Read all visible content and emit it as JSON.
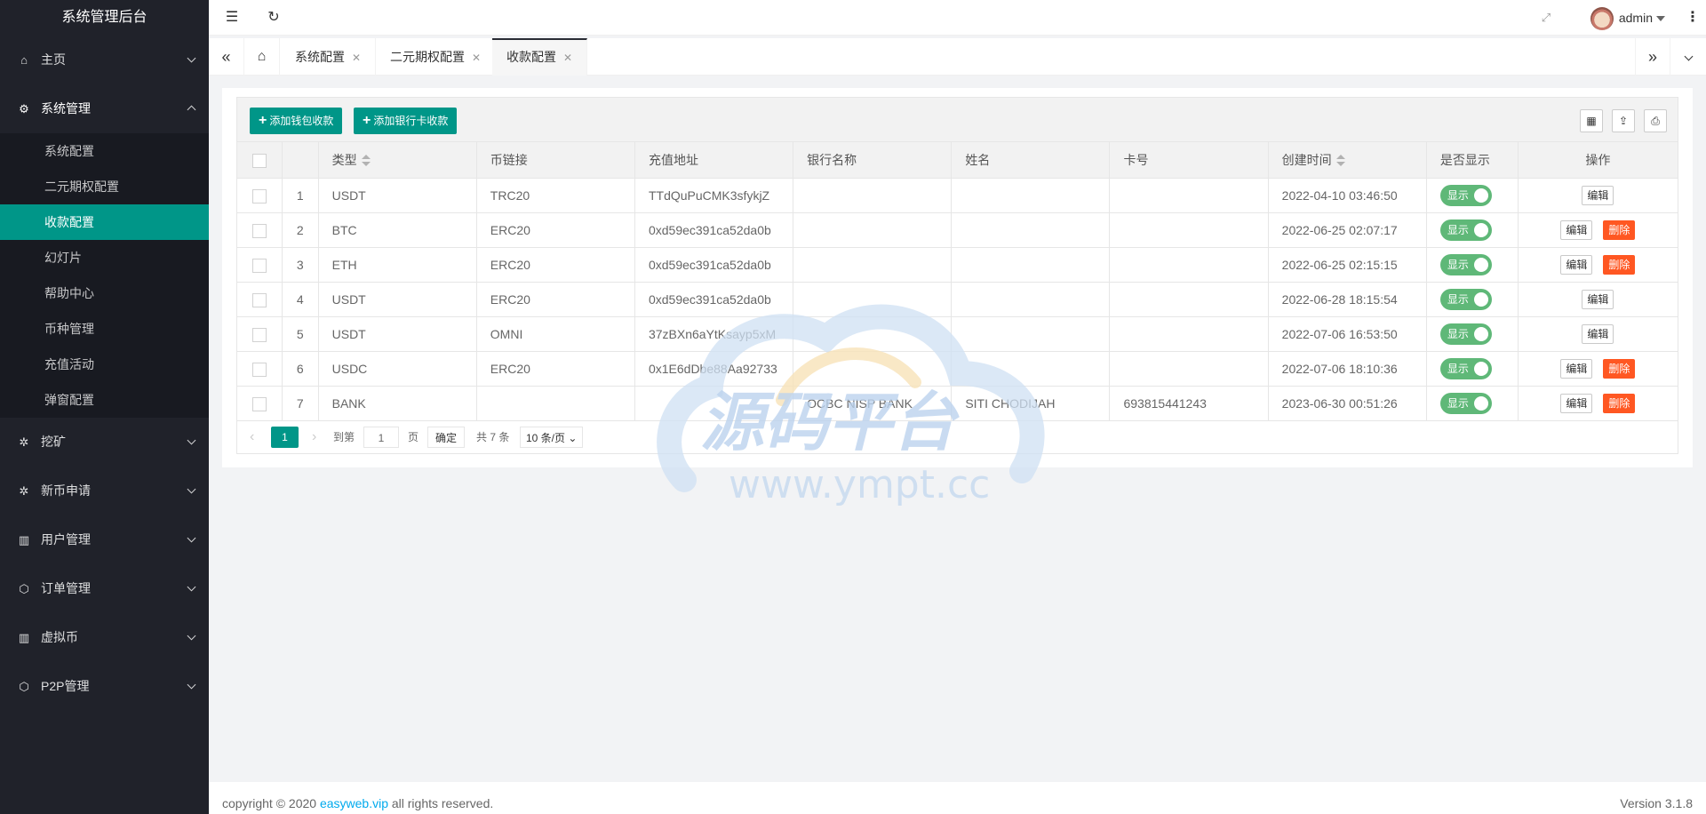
{
  "app": {
    "title": "系统管理后台"
  },
  "sidebar": {
    "items": [
      {
        "label": "主页",
        "icon": "home-icon"
      },
      {
        "label": "系统管理",
        "icon": "gear-icon",
        "open": true,
        "children": [
          "系统配置",
          "二元期权配置",
          "收款配置",
          "幻灯片",
          "帮助中心",
          "币种管理",
          "充值活动",
          "弹窗配置"
        ],
        "active_child": "收款配置"
      },
      {
        "label": "挖矿",
        "icon": "settings-icon"
      },
      {
        "label": "新币申请",
        "icon": "settings-icon"
      },
      {
        "label": "用户管理",
        "icon": "book-icon"
      },
      {
        "label": "订单管理",
        "icon": "cube-icon"
      },
      {
        "label": "虚拟币",
        "icon": "book-icon"
      },
      {
        "label": "P2P管理",
        "icon": "cube-icon"
      }
    ]
  },
  "header": {
    "user": "admin"
  },
  "tabs": [
    {
      "label": "系统配置"
    },
    {
      "label": "二元期权配置"
    },
    {
      "label": "收款配置",
      "active": true
    }
  ],
  "toolbar": {
    "add_wallet": "添加钱包收款",
    "add_bank": "添加银行卡收款"
  },
  "table": {
    "columns": [
      "类型",
      "币链接",
      "充值地址",
      "银行名称",
      "姓名",
      "卡号",
      "创建时间",
      "是否显示",
      "操作"
    ],
    "rows": [
      {
        "no": "1",
        "type": "USDT",
        "chain": "TRC20",
        "address": "TTdQuPuCMK3sfykjZ",
        "bank": "",
        "name": "",
        "card": "",
        "time": "2022-04-10 03:46:50",
        "show": "显示",
        "delete": false
      },
      {
        "no": "2",
        "type": "BTC",
        "chain": "ERC20",
        "address": "0xd59ec391ca52da0b",
        "bank": "",
        "name": "",
        "card": "",
        "time": "2022-06-25 02:07:17",
        "show": "显示",
        "delete": true
      },
      {
        "no": "3",
        "type": "ETH",
        "chain": "ERC20",
        "address": "0xd59ec391ca52da0b",
        "bank": "",
        "name": "",
        "card": "",
        "time": "2022-06-25 02:15:15",
        "show": "显示",
        "delete": true
      },
      {
        "no": "4",
        "type": "USDT",
        "chain": "ERC20",
        "address": "0xd59ec391ca52da0b",
        "bank": "",
        "name": "",
        "card": "",
        "time": "2022-06-28 18:15:54",
        "show": "显示",
        "delete": false
      },
      {
        "no": "5",
        "type": "USDT",
        "chain": "OMNI",
        "address": "37zBXn6aYtKsayp5xM",
        "bank": "",
        "name": "",
        "card": "",
        "time": "2022-07-06 16:53:50",
        "show": "显示",
        "delete": false
      },
      {
        "no": "6",
        "type": "USDC",
        "chain": "ERC20",
        "address": "0x1E6dDbe88Aa92733",
        "bank": "",
        "name": "",
        "card": "",
        "time": "2022-07-06 18:10:36",
        "show": "显示",
        "delete": true
      },
      {
        "no": "7",
        "type": "BANK",
        "chain": "",
        "address": "",
        "bank": "OCBC NISP BANK",
        "name": "SITI CHODIJAH",
        "card": "693815441243",
        "time": "2023-06-30 00:51:26",
        "show": "显示",
        "delete": true
      }
    ],
    "edit_label": "编辑",
    "delete_label": "删除"
  },
  "pager": {
    "current": "1",
    "goto_label": "到第",
    "page_input": "1",
    "page_unit": "页",
    "confirm": "确定",
    "total": "共 7 条",
    "per_page": "10 条/页"
  },
  "watermark": {
    "cn": "源码平台",
    "url": "www.ympt.cc"
  },
  "footer": {
    "copyright_prefix": "copyright © 2020 ",
    "link": "easyweb.vip",
    "copyright_suffix": " all rights reserved.",
    "version": "Version 3.1.8"
  },
  "colors": {
    "accent": "#009688",
    "danger": "#ff5722",
    "switch_on": "#5fb878",
    "sidebar_bg": "#20222a"
  }
}
